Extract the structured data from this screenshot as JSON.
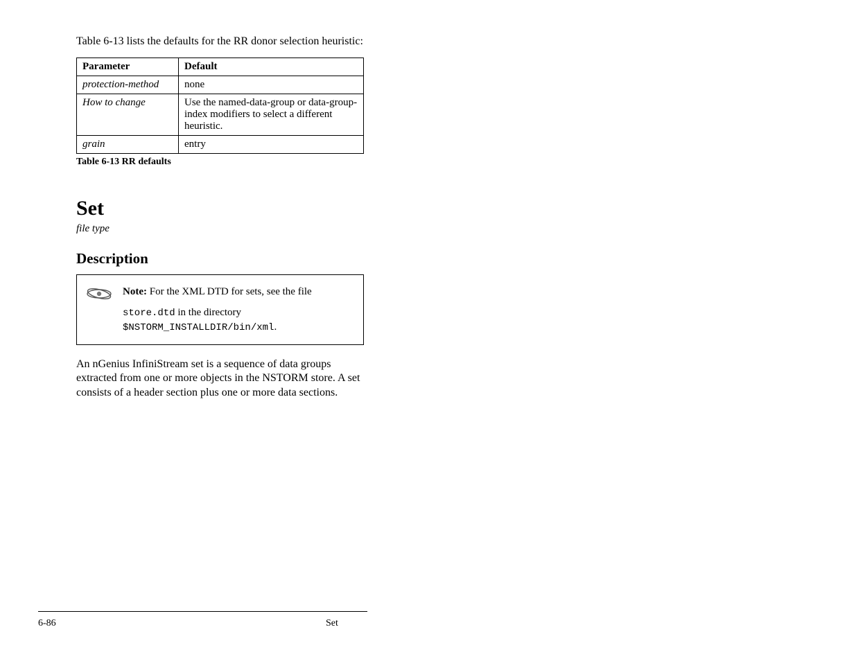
{
  "lead": "Table 6-13 lists the defaults for the RR donor selection heuristic:",
  "table": {
    "caption": "Table 6-13  RR defaults",
    "h1": "Parameter",
    "h2": "Default",
    "rows": [
      {
        "k": "protection-method",
        "v": "none"
      },
      {
        "k": "How to change",
        "v": "Use the named-data-group or data-group-index modifiers to select a different heuristic."
      },
      {
        "k": "grain",
        "v": "entry"
      }
    ]
  },
  "ftype": {
    "title": "Set",
    "tag": "file type"
  },
  "section": "Description",
  "note": {
    "label": "Note:",
    "head": "For the XML DTD for sets, see the file ",
    "file": "store.dtd",
    "tail": " in the directory ",
    "path": "$NSTORM_INSTALLDIR/bin/xml",
    "end": "."
  },
  "para": "An nGenius InfiniStream set is a sequence of data groups extracted from one or more objects in the NSTORM store. A set consists of a header section plus one or more data sections.",
  "footer": {
    "left": "6-86",
    "right": "Set"
  }
}
